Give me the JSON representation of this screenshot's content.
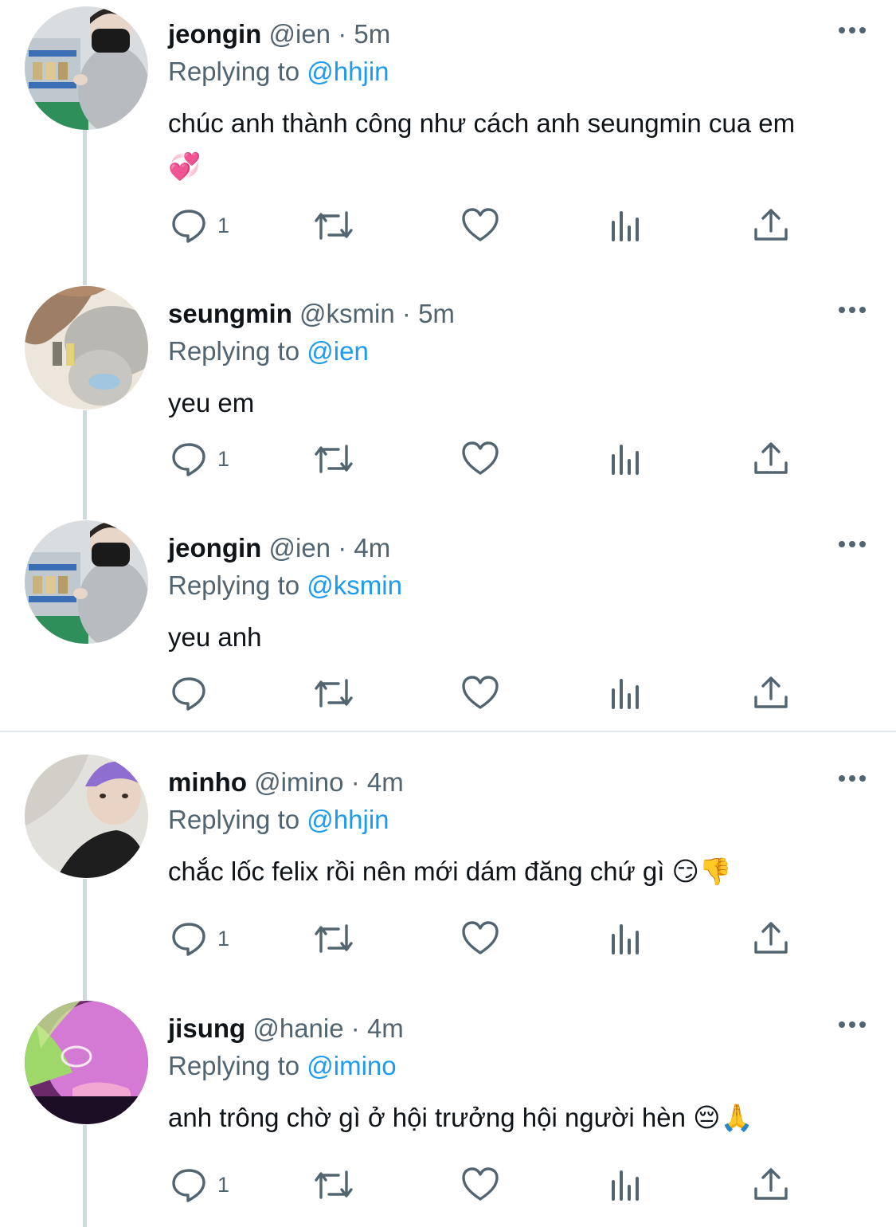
{
  "replying_label": "Replying to",
  "tweets": [
    {
      "name": "jeongin",
      "handle": "@ien",
      "separator": "·",
      "time": "5m",
      "reply_to": "@hhjin",
      "text": "chúc anh thành công như cách anh seungmin cua em",
      "emoji": "💞",
      "reply_count": "1",
      "avatar_icon": "avatar-photo"
    },
    {
      "name": "seungmin",
      "handle": "@ksmin",
      "separator": "·",
      "time": "5m",
      "reply_to": "@ien",
      "text": "yeu em",
      "emoji": "",
      "reply_count": "1",
      "avatar_icon": "avatar-photo"
    },
    {
      "name": "jeongin",
      "handle": "@ien",
      "separator": "·",
      "time": "4m",
      "reply_to": "@ksmin",
      "text": "yeu anh",
      "emoji": "",
      "reply_count": "",
      "avatar_icon": "avatar-photo"
    },
    {
      "name": "minho",
      "handle": "@imino",
      "separator": "·",
      "time": "4m",
      "reply_to": "@hhjin",
      "text": "chắc lốc felix rồi nên mới dám đăng chứ gì",
      "emoji": "😏👎",
      "reply_count": "1",
      "avatar_icon": "avatar-photo"
    },
    {
      "name": "jisung",
      "handle": "@hanie",
      "separator": "·",
      "time": "4m",
      "reply_to": "@imino",
      "text": "anh trông chờ gì ở hội trưởng hội người hèn",
      "emoji": "😔🙏",
      "reply_count": "1",
      "avatar_icon": "avatar-photo"
    }
  ],
  "colors": {
    "text": "#0f1419",
    "secondary": "#536471",
    "link": "#1d9bf0",
    "thread_line": "#cfd9de"
  }
}
